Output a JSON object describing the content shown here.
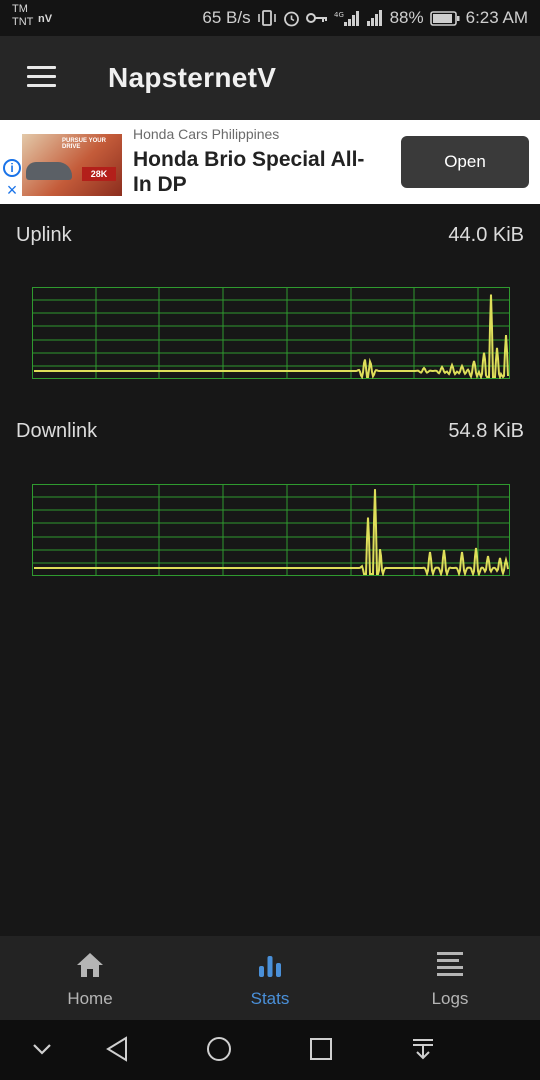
{
  "status_bar": {
    "carrier_top": "TM",
    "carrier_bottom": "TNT",
    "carrier_suffix": "nV",
    "net_speed": "65 B/s",
    "battery": "88%",
    "time": "6:23 AM"
  },
  "app_bar": {
    "title": "NapsternetV",
    "menu_icon": "hamburger-menu-icon"
  },
  "ad": {
    "advertiser": "Honda Cars Philippines",
    "headline": "Honda Brio Special All-In DP",
    "open_label": "Open",
    "image_tag": "PURSUE YOUR DRIVE",
    "image_badge": "28K",
    "info_icon": "info-icon",
    "close_icon": "close-icon"
  },
  "stats": {
    "uplink": {
      "label": "Uplink",
      "value": "44.0 KiB"
    },
    "downlink": {
      "label": "Downlink",
      "value": "54.8 KiB"
    }
  },
  "graph_style": {
    "background": "#171717",
    "grid": "#2f9a2f",
    "line": "#dede5a"
  },
  "bottom_nav": [
    {
      "label": "Home",
      "icon": "home-icon",
      "active": false
    },
    {
      "label": "Stats",
      "icon": "bar-chart-icon",
      "active": true
    },
    {
      "label": "Logs",
      "icon": "list-lines-icon",
      "active": false
    }
  ],
  "accent_color": "#4a90d9"
}
